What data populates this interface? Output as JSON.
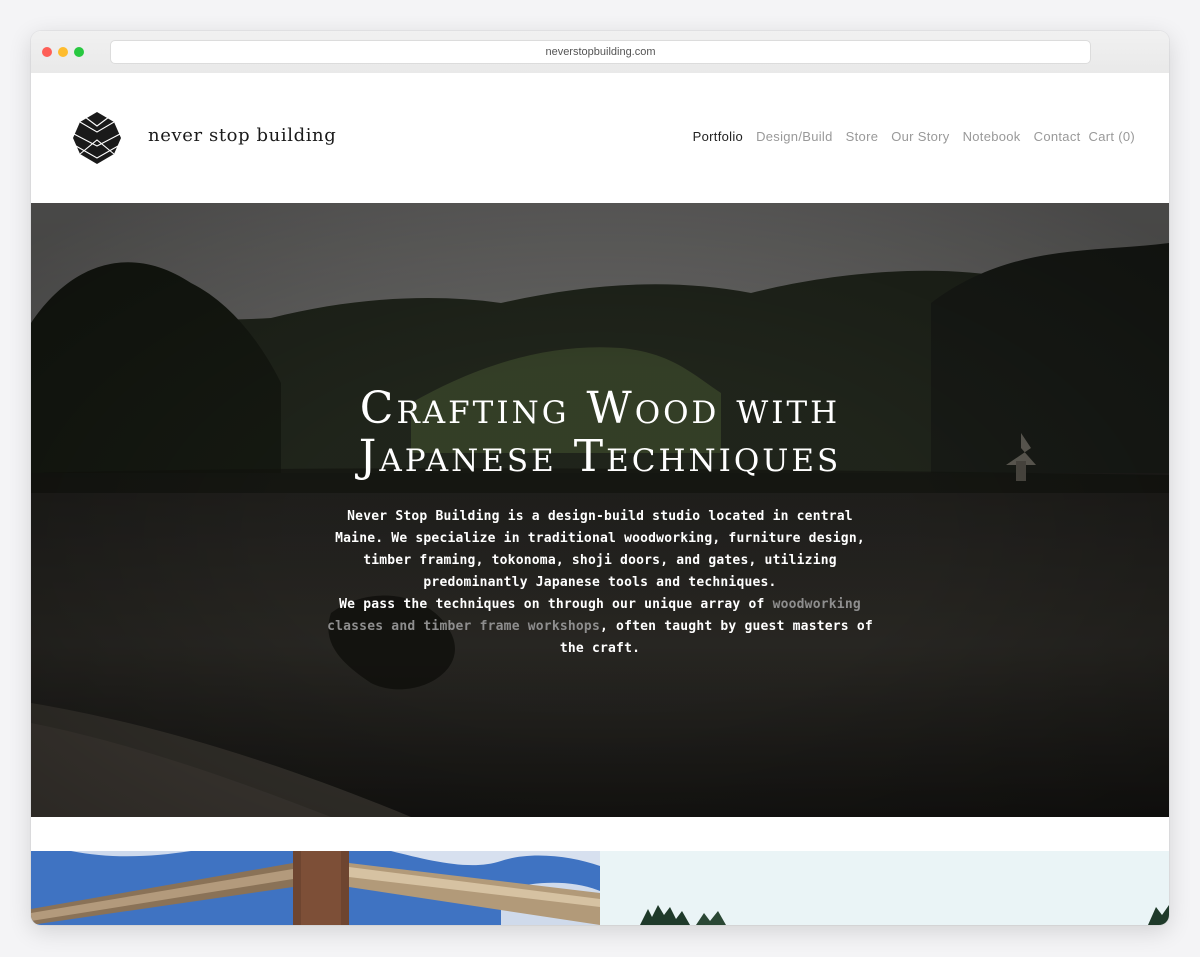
{
  "browser": {
    "url": "neverstopbuilding.com"
  },
  "header": {
    "site_title": "never stop building",
    "logo_icon": "pinecone-logo-icon",
    "nav": [
      {
        "label": "Portfolio",
        "active": true
      },
      {
        "label": "Design/Build",
        "active": false
      },
      {
        "label": "Store",
        "active": false
      },
      {
        "label": "Our Story",
        "active": false
      },
      {
        "label": "Notebook",
        "active": false
      },
      {
        "label": "Contact",
        "active": false
      }
    ],
    "cart_label": "Cart (0)"
  },
  "hero": {
    "title_line1": "Crafting Wood with",
    "title_line2": "Japanese Techniques",
    "paragraph1": "Never Stop Building is a design-build studio located in central Maine. We specialize in traditional woodworking, furniture design, timber framing, tokonoma, shoji doors, and gates, utilizing predominantly Japanese tools and techniques.",
    "paragraph2_before": "We pass the techniques on through our unique array of ",
    "paragraph2_link": "woodworking classes and timber frame workshops",
    "paragraph2_after": ", often taught by guest masters of the craft."
  },
  "colors": {
    "nav_active": "#222222",
    "nav_inactive": "#999999",
    "hero_link": "#8e8e8e"
  }
}
